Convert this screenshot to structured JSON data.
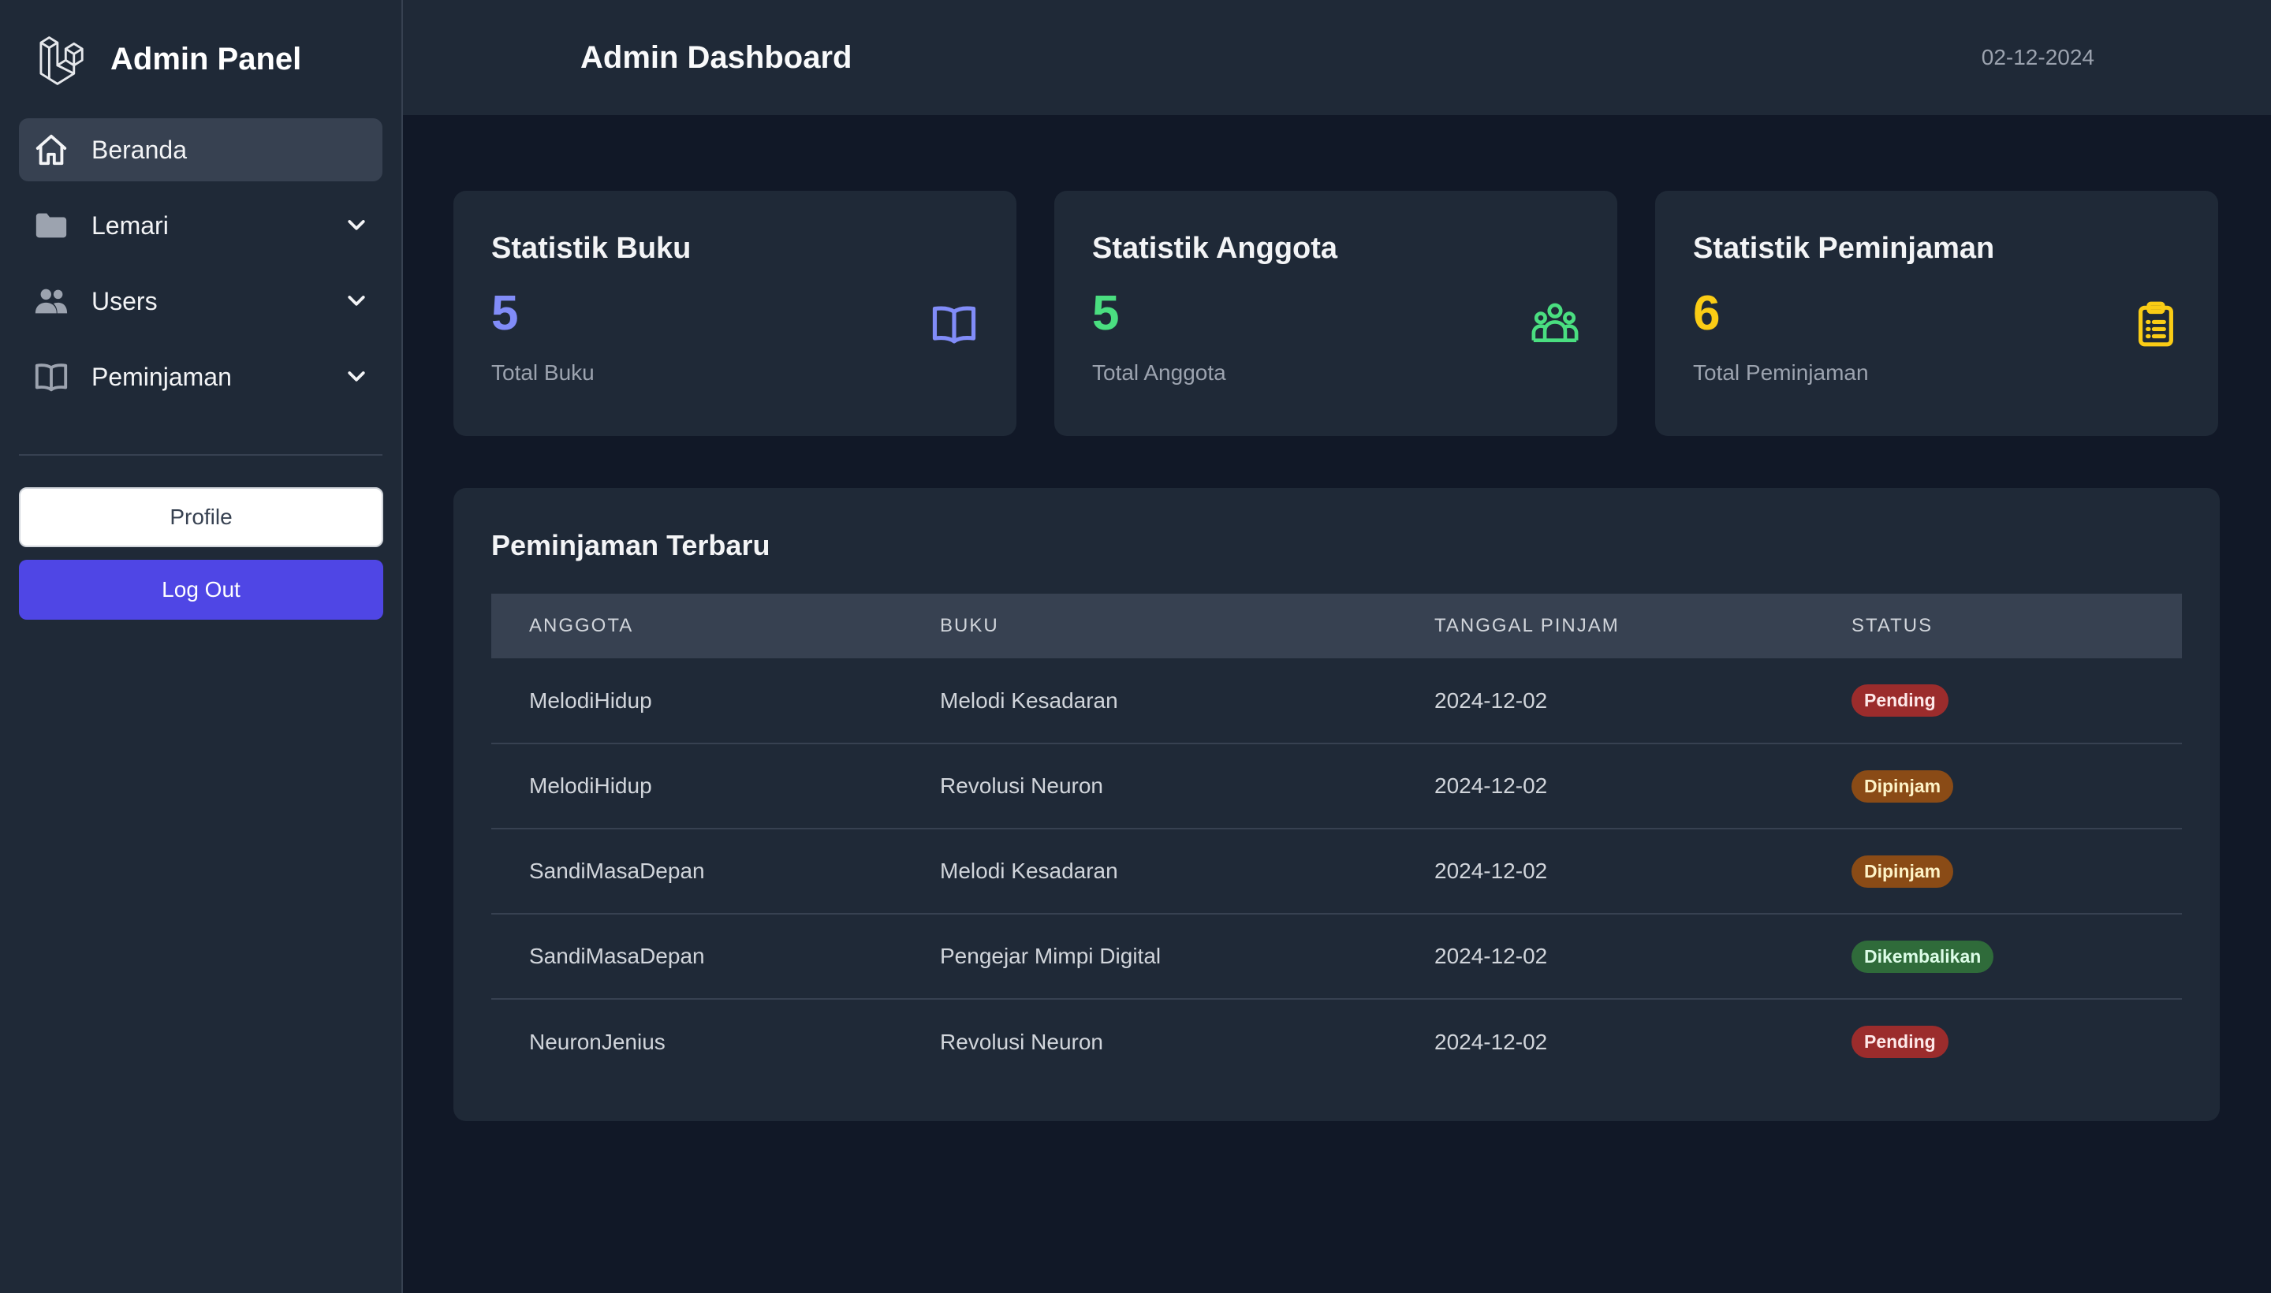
{
  "sidebar": {
    "brand": "Admin Panel",
    "items": [
      {
        "label": "Beranda",
        "icon": "home-icon",
        "active": true
      },
      {
        "label": "Lemari",
        "icon": "folder-icon"
      },
      {
        "label": "Users",
        "icon": "users-icon"
      },
      {
        "label": "Peminjaman",
        "icon": "book-icon"
      }
    ],
    "profile_label": "Profile",
    "logout_label": "Log Out"
  },
  "header": {
    "title": "Admin Dashboard",
    "date": "02-12-2024"
  },
  "stats": [
    {
      "title": "Statistik Buku",
      "value": "5",
      "label": "Total Buku",
      "color": "#818cf8",
      "icon": "book-open-icon"
    },
    {
      "title": "Statistik Anggota",
      "value": "5",
      "label": "Total Anggota",
      "color": "#4ade80",
      "icon": "user-group-icon"
    },
    {
      "title": "Statistik Peminjaman",
      "value": "6",
      "label": "Total Peminjaman",
      "color": "#facc15",
      "icon": "clipboard-list-icon"
    }
  ],
  "recent": {
    "title": "Peminjaman Terbaru",
    "columns": [
      "ANGGOTA",
      "BUKU",
      "TANGGAL PINJAM",
      "STATUS"
    ],
    "rows": [
      {
        "member": "MelodiHidup",
        "book": "Melodi Kesadaran",
        "date": "2024-12-02",
        "status": "Pending"
      },
      {
        "member": "MelodiHidup",
        "book": "Revolusi Neuron",
        "date": "2024-12-02",
        "status": "Dipinjam"
      },
      {
        "member": "SandiMasaDepan",
        "book": "Melodi Kesadaran",
        "date": "2024-12-02",
        "status": "Dipinjam"
      },
      {
        "member": "SandiMasaDepan",
        "book": "Pengejar Mimpi Digital",
        "date": "2024-12-02",
        "status": "Dikembalikan"
      },
      {
        "member": "NeuronJenius",
        "book": "Revolusi Neuron",
        "date": "2024-12-02",
        "status": "Pending"
      }
    ]
  },
  "status_colors": {
    "Pending": {
      "bg": "#9b2c2c",
      "fg": "#fde8e8"
    },
    "Dipinjam": {
      "bg": "#8a4b16",
      "fg": "#fef3c7"
    },
    "Dikembalikan": {
      "bg": "#2f6b3a",
      "fg": "#dcfce7"
    }
  }
}
